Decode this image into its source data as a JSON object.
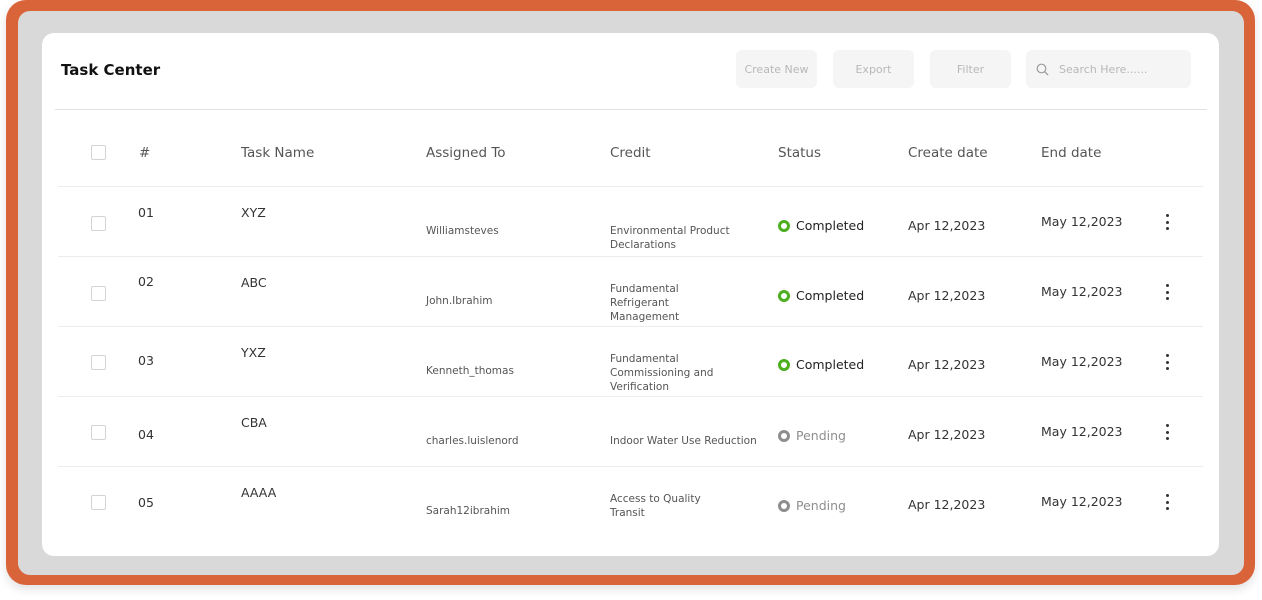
{
  "header": {
    "title": "Task Center"
  },
  "toolbar": {
    "create_label": "Create New",
    "export_label": "Export",
    "filter_label": "Filter",
    "search_placeholder": "Search Here......"
  },
  "table": {
    "columns": [
      "#",
      "Task Name",
      "Assigned To",
      "Credit",
      "Status",
      "Create date",
      "End date"
    ],
    "rows": [
      {
        "num": "01",
        "task": "XYZ",
        "assigned": "Williamsteves",
        "credit": "Environmental Product Declarations",
        "status": "Completed",
        "create": "Apr 12,2023",
        "end": "May 12,2023"
      },
      {
        "num": "02",
        "task": "ABC",
        "assigned": "John.Ibrahim",
        "credit": "Fundamental Refrigerant Management",
        "status": "Completed",
        "create": "Apr 12,2023",
        "end": "May 12,2023"
      },
      {
        "num": "03",
        "task": "YXZ",
        "assigned": "Kenneth_thomas",
        "credit": "Fundamental Commissioning and Verification",
        "status": "Completed",
        "create": "Apr 12,2023",
        "end": "May 12,2023"
      },
      {
        "num": "04",
        "task": "CBA",
        "assigned": "charles.luislenord",
        "credit": "Indoor Water Use Reduction",
        "status": "Pending",
        "create": "Apr 12,2023",
        "end": "May 12,2023"
      },
      {
        "num": "05",
        "task": "AAAA",
        "assigned": "Sarah12ibrahim",
        "credit": "Access to Quality Transit",
        "status": "Pending",
        "create": "Apr 12,2023",
        "end": "May 12,2023"
      }
    ]
  },
  "colors": {
    "frame": "#d9643a",
    "completed": "#4caf1f",
    "pending": "#8e8e8e"
  }
}
